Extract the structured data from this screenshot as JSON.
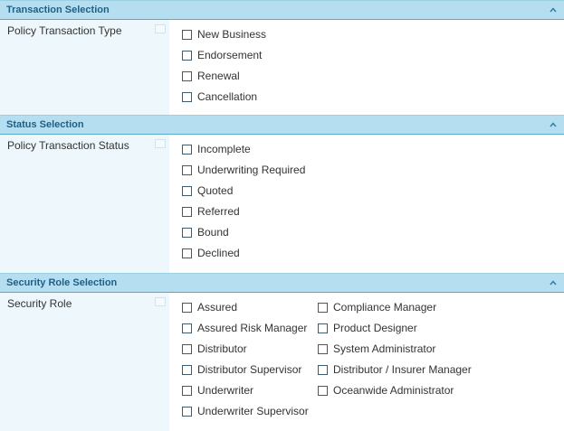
{
  "sections": [
    {
      "title": "Transaction Selection",
      "field_label": "Policy Transaction Type",
      "options": [
        "New Business",
        "Endorsement",
        "Renewal",
        "Cancellation"
      ]
    },
    {
      "title": "Status Selection",
      "field_label": "Policy Transaction Status",
      "options": [
        "Incomplete",
        "Underwriting Required",
        "Quoted",
        "Referred",
        "Bound",
        "Declined"
      ]
    },
    {
      "title": "Security Role Selection",
      "field_label": "Security Role",
      "options_col1": [
        "Assured",
        "Assured Risk Manager",
        "Distributor",
        "Distributor Supervisor",
        "Underwriter",
        "Underwriter Supervisor"
      ],
      "options_col2": [
        "Compliance Manager",
        "Product Designer",
        "System Administrator",
        "Distributor / Insurer Manager",
        "Oceanwide Administrator"
      ]
    }
  ],
  "icons": {
    "collapse": "chevron-up-icon",
    "help": "help-icon"
  },
  "colors": {
    "header_bg": "#b5dff0",
    "header_text": "#1f5f86",
    "label_bg": "#edf7fc"
  }
}
